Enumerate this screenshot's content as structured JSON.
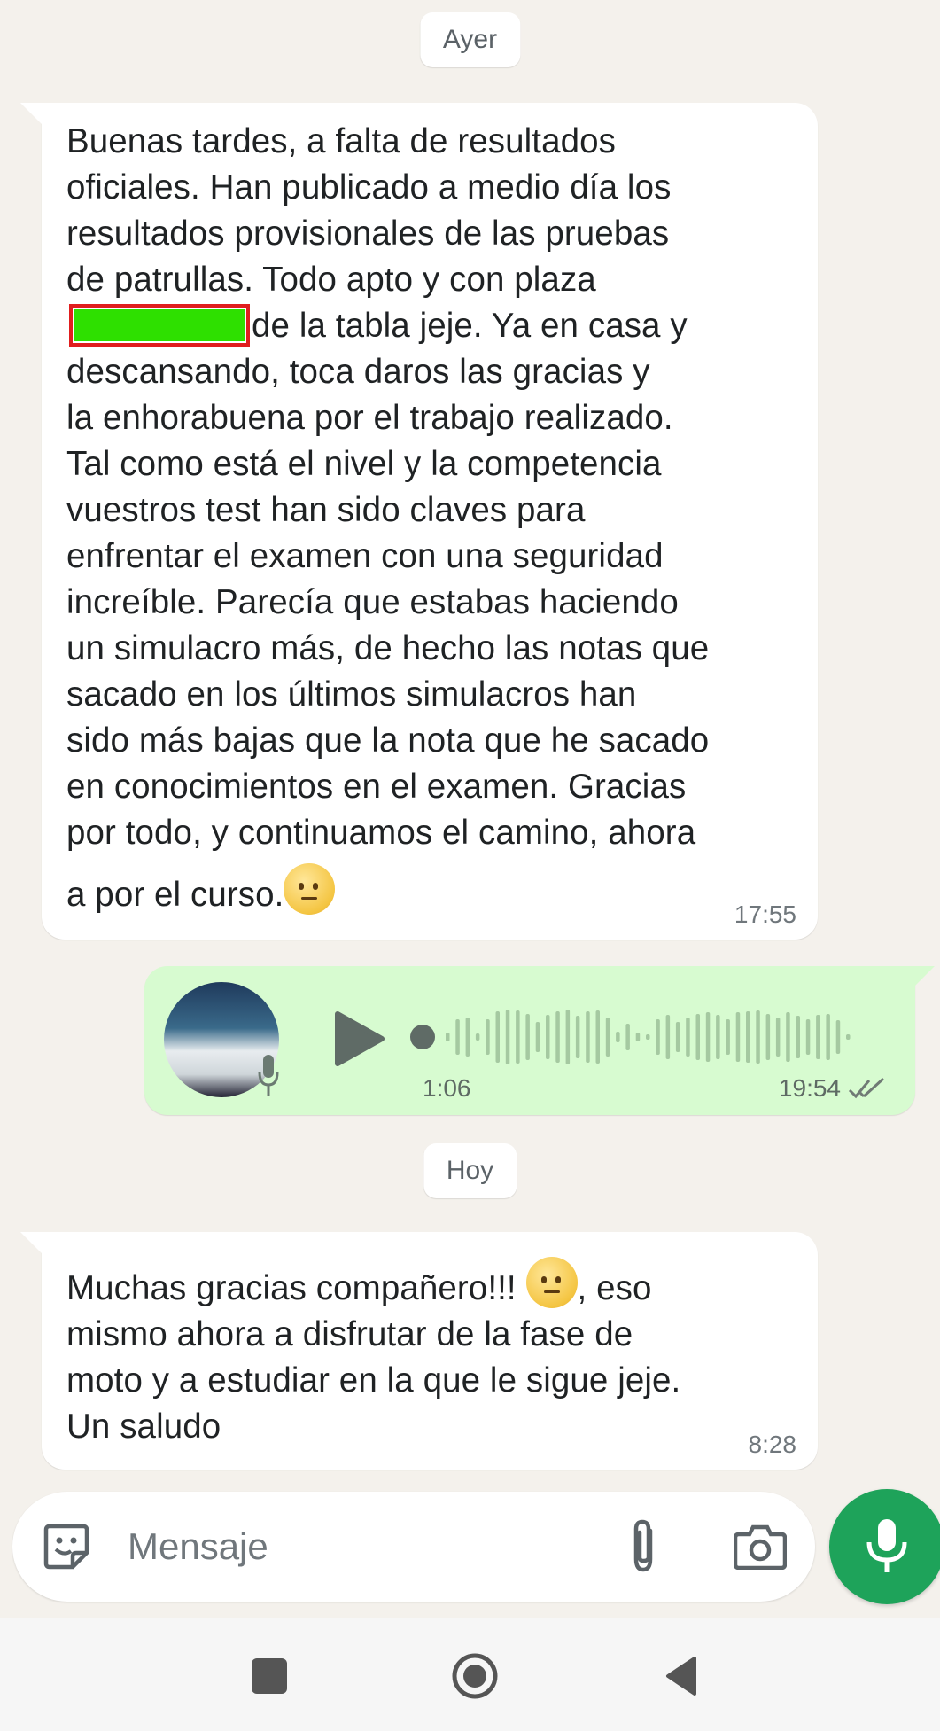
{
  "day_separators": {
    "yesterday": "Ayer",
    "today": "Hoy"
  },
  "messages": [
    {
      "direction": "incoming",
      "text_line1": "Buenas tardes, a falta de resultados",
      "text_line2": "oficiales. Han publicado a medio día los",
      "text_line3": "resultados provisionales de las pruebas",
      "text_line4": "de patrullas. Todo apto y con plaza",
      "text_line5_after_redaction": "de la tabla jeje. Ya en casa y",
      "text_line6": "descansando, toca daros las gracias y",
      "text_line7": "la enhorabuena por el trabajo realizado.",
      "text_line8": "Tal como está el nivel y la competencia",
      "text_line9": "vuestros test han sido claves para",
      "text_line10": "enfrentar el examen con una seguridad",
      "text_line11": "increíble. Parecía que estabas haciendo",
      "text_line12": "un simulacro más, de hecho las notas que",
      "text_line13": "sacado en los últimos simulacros han",
      "text_line14": "sido más bajas que la nota que he sacado",
      "text_line15": "en conocimientos en el examen. Gracias",
      "text_line16": "por todo, y continuamos el camino, ahora",
      "text_line17": "a por el curso.",
      "emoji": "saluting-face-emoji",
      "time": "17:55"
    },
    {
      "direction": "outgoing",
      "type": "voice-note",
      "duration": "1:06",
      "time": "19:54",
      "status": "read-double-check"
    },
    {
      "direction": "incoming",
      "text_line1_before_emoji": "Muchas gracias compañero!!! ",
      "text_line1_after_emoji": ", eso",
      "text_line2": "mismo ahora a disfrutar de la fase de",
      "text_line3": "moto y a estudiar en la que le sigue jeje.",
      "text_line4": "Un saludo",
      "emoji": "saluting-face-emoji",
      "time": "8:28"
    }
  ],
  "composer": {
    "placeholder": "Mensaje",
    "icons": [
      "sticker-icon",
      "paperclip-icon",
      "camera-icon",
      "microphone-icon"
    ]
  },
  "colors": {
    "chat_background": "#f4f1ec",
    "incoming_bubble": "#ffffff",
    "outgoing_bubble": "#d7fbd0",
    "fab_green": "#1ea35a",
    "redaction_fill": "#2ee000",
    "redaction_border": "#e01e1e"
  }
}
